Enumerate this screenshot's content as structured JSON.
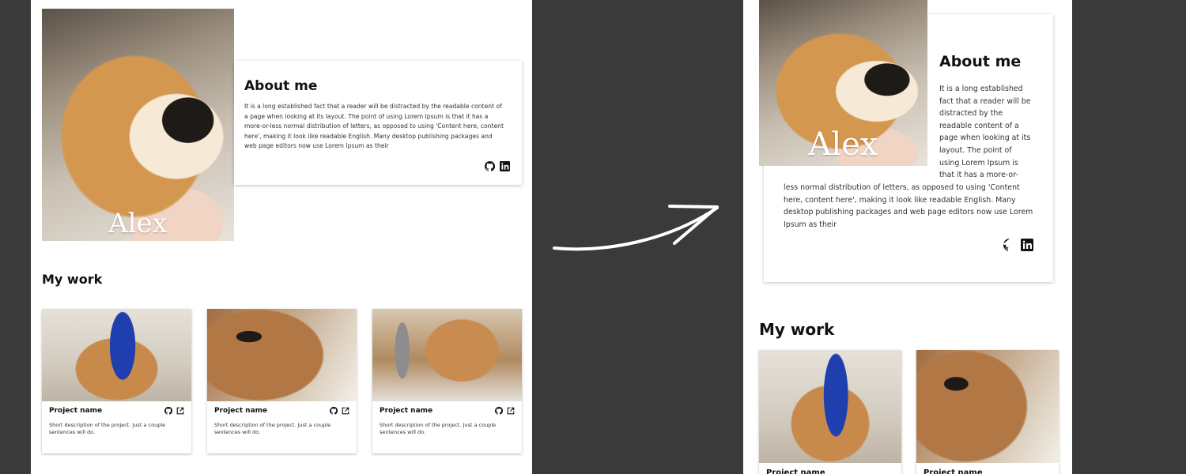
{
  "profile": {
    "name": "Alex",
    "about_title": "About me",
    "about_text": "It is a long established fact that a reader will be distracted by the readable content of a page when looking at its layout. The point of using Lorem Ipsum is that it has a more-or-less normal distribution of letters, as opposed to using 'Content here, content here', making it look like readable English. Many desktop publishing packages and web page editors now use Lorem Ipsum as their",
    "about_text_lines_narrow": [
      "It is a long established",
      "fact that a reader will be",
      "distracted by the",
      "readable content of a",
      "page when looking at its",
      "layout. The point of",
      "using Lorem Ipsum is",
      "that it has a more-or-"
    ],
    "about_text_rest_narrow": "less normal distribution of letters, as opposed to using 'Content here, content here', making it look like readable English. Many desktop publishing packages and web page editors now use Lorem Ipsum as their",
    "social_icons": [
      "github-icon",
      "linkedin-icon"
    ]
  },
  "work": {
    "title": "My work",
    "projects": [
      {
        "name": "Project name",
        "description": "Short description of the project. Just a couple sentences will do.",
        "icons": [
          "github-icon",
          "external-link-icon"
        ]
      },
      {
        "name": "Project name",
        "description": "Short description of the project. Just a couple sentences will do.",
        "icons": [
          "github-icon",
          "external-link-icon"
        ]
      },
      {
        "name": "Project name",
        "description": "Short description of the project. Just a couple sentences will do.",
        "icons": [
          "github-icon",
          "external-link-icon"
        ]
      }
    ]
  },
  "colors": {
    "background": "#3a3a3a",
    "panel": "#ffffff",
    "text": "#111111",
    "arrow": "#ffffff"
  }
}
